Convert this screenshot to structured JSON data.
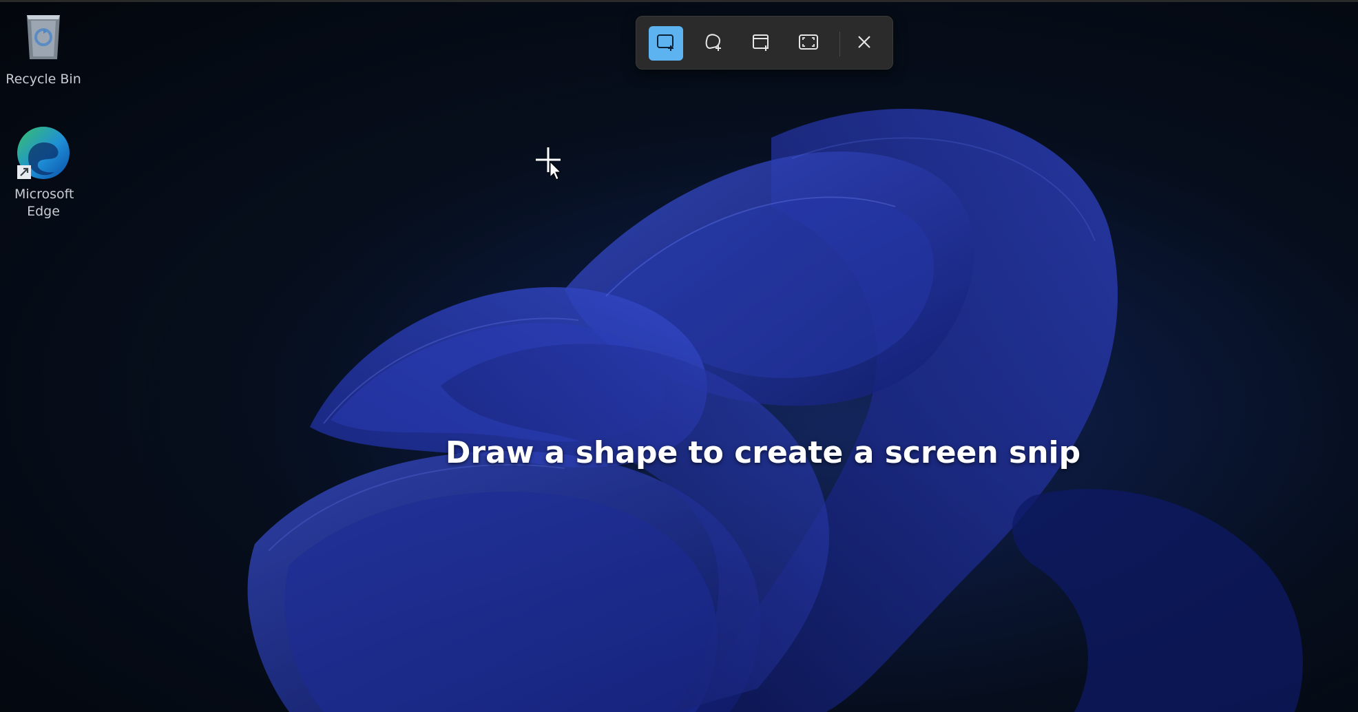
{
  "desktop": {
    "icons": [
      {
        "label": "Recycle Bin",
        "icon": "recycle-bin-icon"
      },
      {
        "label": "Microsoft Edge",
        "icon": "edge-icon"
      }
    ]
  },
  "snip_toolbar": {
    "modes": [
      {
        "name": "Rectangle mode",
        "icon": "rectangle-snip-icon",
        "selected": true
      },
      {
        "name": "Freeform mode",
        "icon": "freeform-snip-icon",
        "selected": false
      },
      {
        "name": "Window mode",
        "icon": "window-snip-icon",
        "selected": false
      },
      {
        "name": "Full screen mode",
        "icon": "fullscreen-snip-icon",
        "selected": false
      }
    ],
    "close_icon": "close-icon",
    "accent_color": "#5cb3f0"
  },
  "instruction": {
    "text": "Draw a shape to create a screen snip"
  },
  "cursor": {
    "icon": "crosshair-cursor-icon"
  }
}
